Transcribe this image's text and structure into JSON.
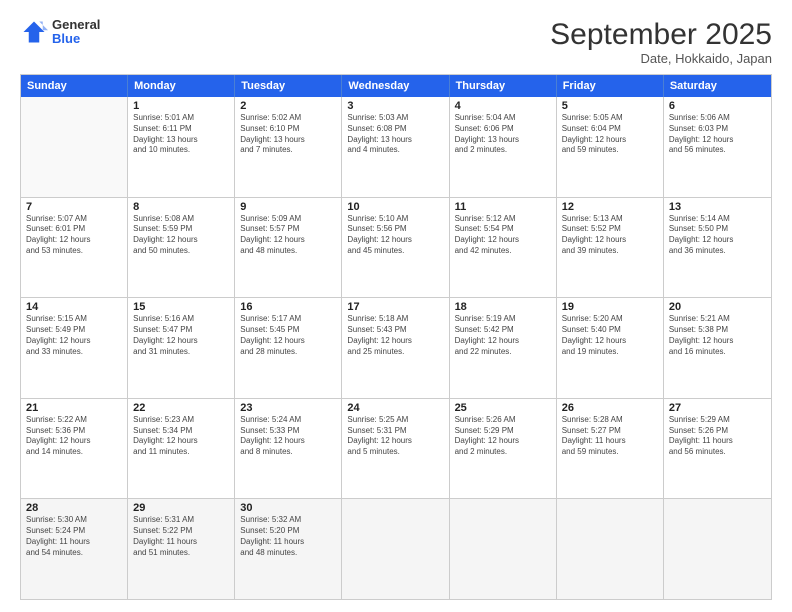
{
  "logo": {
    "general": "General",
    "blue": "Blue"
  },
  "header": {
    "month": "September 2025",
    "subtitle": "Date, Hokkaido, Japan"
  },
  "weekdays": [
    "Sunday",
    "Monday",
    "Tuesday",
    "Wednesday",
    "Thursday",
    "Friday",
    "Saturday"
  ],
  "rows": [
    [
      {
        "day": "",
        "lines": [],
        "empty": true
      },
      {
        "day": "1",
        "lines": [
          "Sunrise: 5:01 AM",
          "Sunset: 6:11 PM",
          "Daylight: 13 hours",
          "and 10 minutes."
        ]
      },
      {
        "day": "2",
        "lines": [
          "Sunrise: 5:02 AM",
          "Sunset: 6:10 PM",
          "Daylight: 13 hours",
          "and 7 minutes."
        ]
      },
      {
        "day": "3",
        "lines": [
          "Sunrise: 5:03 AM",
          "Sunset: 6:08 PM",
          "Daylight: 13 hours",
          "and 4 minutes."
        ]
      },
      {
        "day": "4",
        "lines": [
          "Sunrise: 5:04 AM",
          "Sunset: 6:06 PM",
          "Daylight: 13 hours",
          "and 2 minutes."
        ]
      },
      {
        "day": "5",
        "lines": [
          "Sunrise: 5:05 AM",
          "Sunset: 6:04 PM",
          "Daylight: 12 hours",
          "and 59 minutes."
        ]
      },
      {
        "day": "6",
        "lines": [
          "Sunrise: 5:06 AM",
          "Sunset: 6:03 PM",
          "Daylight: 12 hours",
          "and 56 minutes."
        ]
      }
    ],
    [
      {
        "day": "7",
        "lines": [
          "Sunrise: 5:07 AM",
          "Sunset: 6:01 PM",
          "Daylight: 12 hours",
          "and 53 minutes."
        ]
      },
      {
        "day": "8",
        "lines": [
          "Sunrise: 5:08 AM",
          "Sunset: 5:59 PM",
          "Daylight: 12 hours",
          "and 50 minutes."
        ]
      },
      {
        "day": "9",
        "lines": [
          "Sunrise: 5:09 AM",
          "Sunset: 5:57 PM",
          "Daylight: 12 hours",
          "and 48 minutes."
        ]
      },
      {
        "day": "10",
        "lines": [
          "Sunrise: 5:10 AM",
          "Sunset: 5:56 PM",
          "Daylight: 12 hours",
          "and 45 minutes."
        ]
      },
      {
        "day": "11",
        "lines": [
          "Sunrise: 5:12 AM",
          "Sunset: 5:54 PM",
          "Daylight: 12 hours",
          "and 42 minutes."
        ]
      },
      {
        "day": "12",
        "lines": [
          "Sunrise: 5:13 AM",
          "Sunset: 5:52 PM",
          "Daylight: 12 hours",
          "and 39 minutes."
        ]
      },
      {
        "day": "13",
        "lines": [
          "Sunrise: 5:14 AM",
          "Sunset: 5:50 PM",
          "Daylight: 12 hours",
          "and 36 minutes."
        ]
      }
    ],
    [
      {
        "day": "14",
        "lines": [
          "Sunrise: 5:15 AM",
          "Sunset: 5:49 PM",
          "Daylight: 12 hours",
          "and 33 minutes."
        ]
      },
      {
        "day": "15",
        "lines": [
          "Sunrise: 5:16 AM",
          "Sunset: 5:47 PM",
          "Daylight: 12 hours",
          "and 31 minutes."
        ]
      },
      {
        "day": "16",
        "lines": [
          "Sunrise: 5:17 AM",
          "Sunset: 5:45 PM",
          "Daylight: 12 hours",
          "and 28 minutes."
        ]
      },
      {
        "day": "17",
        "lines": [
          "Sunrise: 5:18 AM",
          "Sunset: 5:43 PM",
          "Daylight: 12 hours",
          "and 25 minutes."
        ]
      },
      {
        "day": "18",
        "lines": [
          "Sunrise: 5:19 AM",
          "Sunset: 5:42 PM",
          "Daylight: 12 hours",
          "and 22 minutes."
        ]
      },
      {
        "day": "19",
        "lines": [
          "Sunrise: 5:20 AM",
          "Sunset: 5:40 PM",
          "Daylight: 12 hours",
          "and 19 minutes."
        ]
      },
      {
        "day": "20",
        "lines": [
          "Sunrise: 5:21 AM",
          "Sunset: 5:38 PM",
          "Daylight: 12 hours",
          "and 16 minutes."
        ]
      }
    ],
    [
      {
        "day": "21",
        "lines": [
          "Sunrise: 5:22 AM",
          "Sunset: 5:36 PM",
          "Daylight: 12 hours",
          "and 14 minutes."
        ]
      },
      {
        "day": "22",
        "lines": [
          "Sunrise: 5:23 AM",
          "Sunset: 5:34 PM",
          "Daylight: 12 hours",
          "and 11 minutes."
        ]
      },
      {
        "day": "23",
        "lines": [
          "Sunrise: 5:24 AM",
          "Sunset: 5:33 PM",
          "Daylight: 12 hours",
          "and 8 minutes."
        ]
      },
      {
        "day": "24",
        "lines": [
          "Sunrise: 5:25 AM",
          "Sunset: 5:31 PM",
          "Daylight: 12 hours",
          "and 5 minutes."
        ]
      },
      {
        "day": "25",
        "lines": [
          "Sunrise: 5:26 AM",
          "Sunset: 5:29 PM",
          "Daylight: 12 hours",
          "and 2 minutes."
        ]
      },
      {
        "day": "26",
        "lines": [
          "Sunrise: 5:28 AM",
          "Sunset: 5:27 PM",
          "Daylight: 11 hours",
          "and 59 minutes."
        ]
      },
      {
        "day": "27",
        "lines": [
          "Sunrise: 5:29 AM",
          "Sunset: 5:26 PM",
          "Daylight: 11 hours",
          "and 56 minutes."
        ]
      }
    ],
    [
      {
        "day": "28",
        "lines": [
          "Sunrise: 5:30 AM",
          "Sunset: 5:24 PM",
          "Daylight: 11 hours",
          "and 54 minutes."
        ]
      },
      {
        "day": "29",
        "lines": [
          "Sunrise: 5:31 AM",
          "Sunset: 5:22 PM",
          "Daylight: 11 hours",
          "and 51 minutes."
        ]
      },
      {
        "day": "30",
        "lines": [
          "Sunrise: 5:32 AM",
          "Sunset: 5:20 PM",
          "Daylight: 11 hours",
          "and 48 minutes."
        ]
      },
      {
        "day": "",
        "lines": [],
        "empty": true
      },
      {
        "day": "",
        "lines": [],
        "empty": true
      },
      {
        "day": "",
        "lines": [],
        "empty": true
      },
      {
        "day": "",
        "lines": [],
        "empty": true
      }
    ]
  ]
}
